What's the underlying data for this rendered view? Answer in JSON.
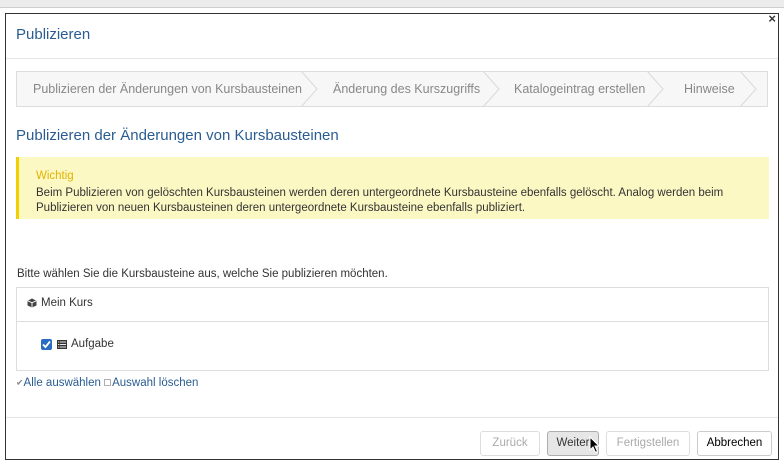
{
  "dialog": {
    "title": "Publizieren",
    "close_symbol": "×"
  },
  "wizard": {
    "steps": [
      {
        "label": "Publizieren der Änderungen von Kursbausteinen"
      },
      {
        "label": "Änderung des Kurszugriffs"
      },
      {
        "label": "Katalogeintrag erstellen"
      },
      {
        "label": "Hinweise"
      }
    ]
  },
  "section": {
    "title": "Publizieren der Änderungen von Kursbausteinen"
  },
  "alert": {
    "title": "Wichtig",
    "text": "Beim Publizieren von gelöschten Kursbausteinen werden deren untergeordnete Kursbausteine ebenfalls gelöscht. Analog werden beim Publizieren von neuen Kursbausteinen deren untergeordnete Kursbausteine ebenfalls publiziert."
  },
  "intro": {
    "text": "Bitte wählen Sie die Kursbausteine aus, welche Sie publizieren möchten."
  },
  "tree": {
    "course": {
      "label": "Mein Kurs",
      "icon": "course-icon"
    },
    "items": [
      {
        "label": "Aufgabe",
        "checked": true,
        "icon": "task-list-icon"
      }
    ]
  },
  "selection": {
    "select_all": "Alle auswählen",
    "clear": "Auswahl löschen"
  },
  "footer": {
    "back": "Zurück",
    "next": "Weiter",
    "finish": "Fertigstellen",
    "cancel": "Abbrechen"
  },
  "colors": {
    "title_blue": "#2a5c91",
    "alert_bg": "#fcf8c4",
    "alert_border": "#f0d000",
    "alert_title": "#e0b400"
  }
}
